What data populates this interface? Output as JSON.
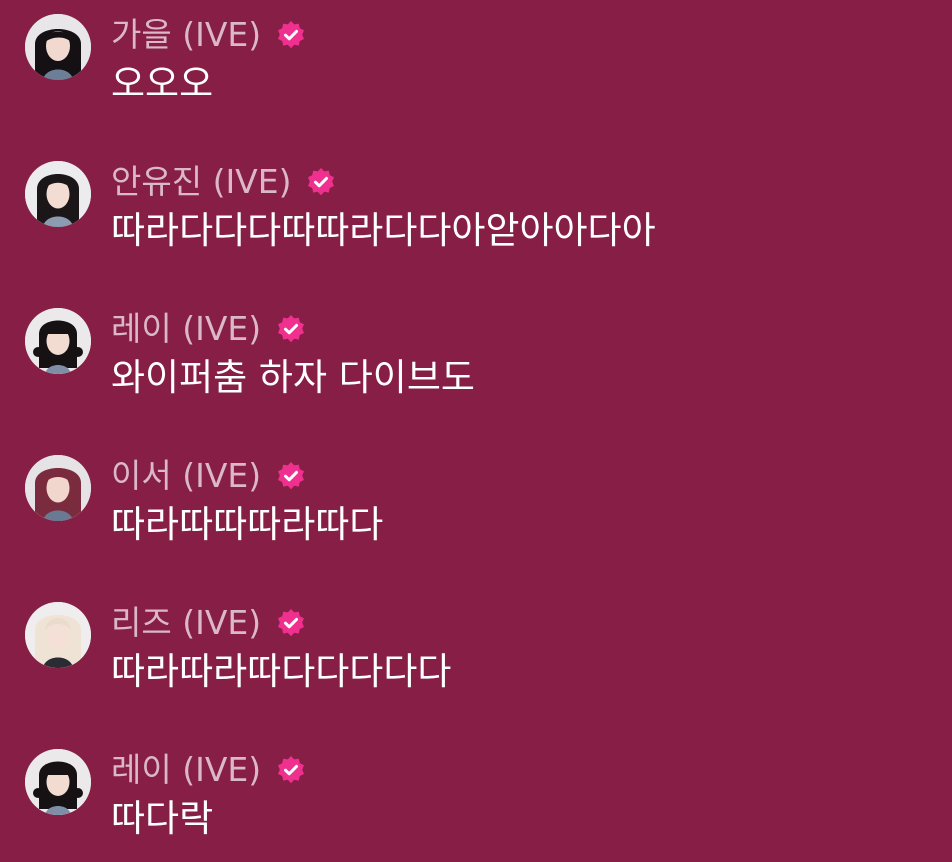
{
  "colors": {
    "background": "#861e45",
    "name_text": "#dbb8c6",
    "message_text": "#ffffff",
    "verified_badge": "#f0308f"
  },
  "messages": [
    {
      "sender": "가을 (IVE)",
      "text": "오오오",
      "avatar_icon": "avatar-gaeul",
      "verified_icon": "verified-badge-icon"
    },
    {
      "sender": "안유진 (IVE)",
      "text": "따라다다다따따라다다아앋아아다아",
      "avatar_icon": "avatar-anyujin",
      "verified_icon": "verified-badge-icon"
    },
    {
      "sender": "레이 (IVE)",
      "text": "와이퍼춤 하자 다이브도",
      "avatar_icon": "avatar-rei",
      "verified_icon": "verified-badge-icon"
    },
    {
      "sender": "이서 (IVE)",
      "text": "따라따따따라따다",
      "avatar_icon": "avatar-leeseo",
      "verified_icon": "verified-badge-icon"
    },
    {
      "sender": "리즈 (IVE)",
      "text": "따라따라따다다다다다",
      "avatar_icon": "avatar-liz",
      "verified_icon": "verified-badge-icon"
    },
    {
      "sender": "레이 (IVE)",
      "text": "따다락",
      "avatar_icon": "avatar-rei",
      "verified_icon": "verified-badge-icon"
    }
  ]
}
